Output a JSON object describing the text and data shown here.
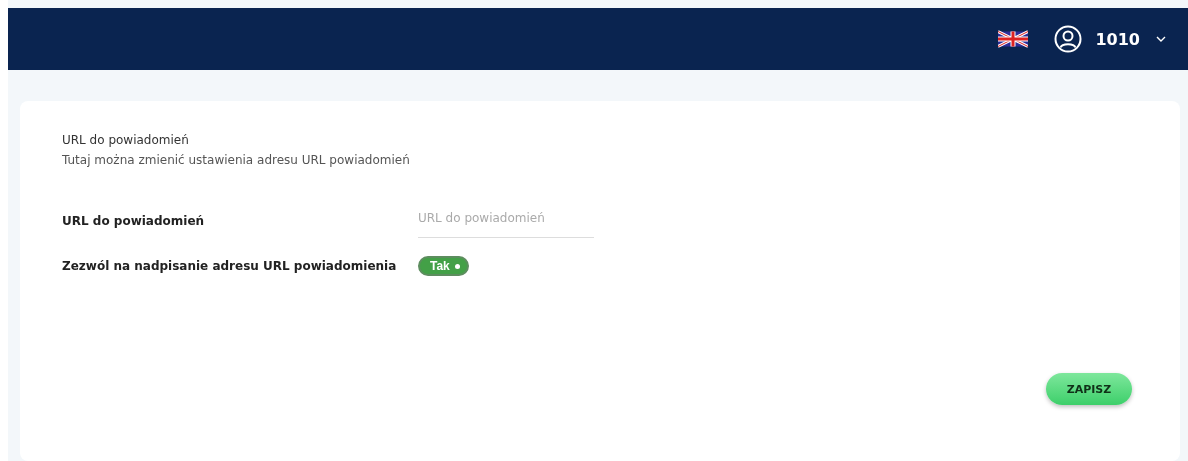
{
  "header": {
    "user": "1010"
  },
  "section": {
    "title": "URL do powiadomień",
    "description": "Tutaj można zmienić ustawienia adresu URL powiadomień"
  },
  "fields": [
    {
      "kind": "text",
      "label": "URL do powiadomień",
      "placeholder": "URL do powiadomień"
    },
    {
      "kind": "toggle",
      "label": "Zezwól na nadpisanie adresu URL powiadomienia",
      "on": true,
      "value_label": "Tak"
    }
  ],
  "save_button": "ZAPISZ"
}
